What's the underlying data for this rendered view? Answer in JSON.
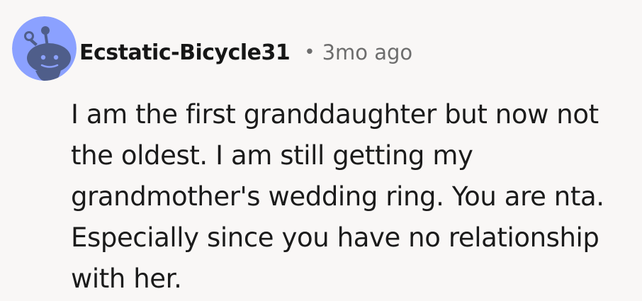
{
  "comment": {
    "author": "Ecstatic-Bicycle31",
    "separator": "•",
    "timestamp": "3mo ago",
    "text": "I am the first granddaughter but now not\nthe oldest. I am still getting my\ngrandmother's wedding ring. You are nta.\nEspecially since you have no relationship\nwith her.",
    "avatar_icon": "snoo-avatar-icon"
  },
  "colors": {
    "background": "#f9f7f6",
    "avatar_background": "#8ba1ff",
    "avatar_figure": "#4f5e8a",
    "author_text": "#161616",
    "meta_text": "#6d6d6d",
    "body_text": "#1b1b1b"
  }
}
